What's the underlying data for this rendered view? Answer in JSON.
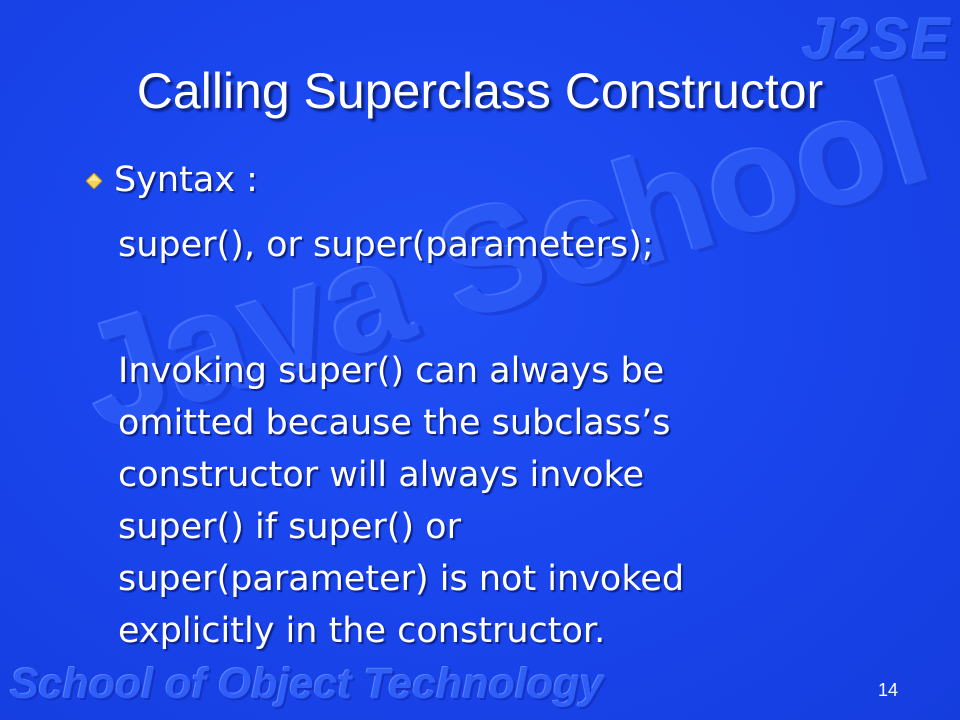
{
  "watermark": {
    "corner": "J2SE",
    "center": "Java School",
    "footer": "School of Object Technology"
  },
  "slide": {
    "title": "Calling Superclass Constructor",
    "bullet": "Syntax :",
    "syntax": "super(), or super(parameters);",
    "paragraph_lines": [
      "Invoking super() can always be",
      "omitted because the subclass’s",
      "constructor will always invoke",
      "super() if super() or",
      "super(parameter) is not invoked",
      "explicitly in the constructor."
    ],
    "page_number": "14"
  },
  "colors": {
    "background": "#1a46ee",
    "text": "#ffffff",
    "bullet": "#f0d050"
  },
  "icons": {
    "bullet": "diamond-bullet-icon"
  }
}
